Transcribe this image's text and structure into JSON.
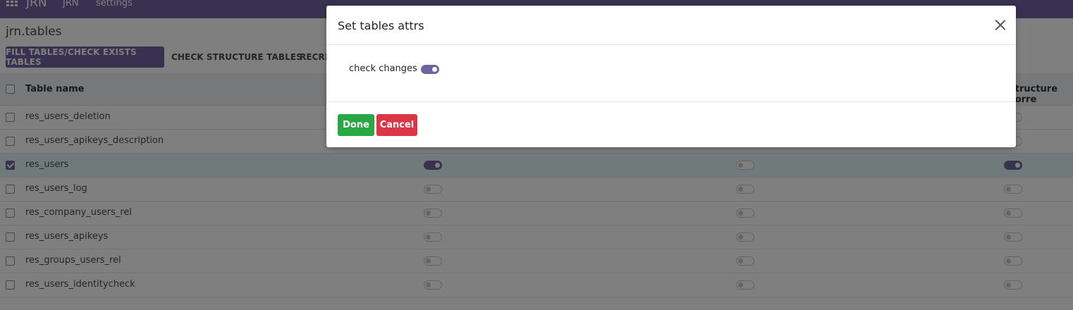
{
  "navbar": {
    "brand": "JRN",
    "menu_items": [
      "JRN",
      "settings"
    ]
  },
  "breadcrumb": "jrn.tables",
  "toolbar": {
    "fill_button": "FILL TABLES/CHECK EXISTS TABLES",
    "check_structure_button": "CHECK STRUCTURE TABLES",
    "recreate_button": "RECRE"
  },
  "table": {
    "header_name": "Table name",
    "header_structure": "structure corre",
    "rows": [
      {
        "name": "res_users_deletion",
        "selected": false,
        "toggles": [
          false,
          false,
          false
        ]
      },
      {
        "name": "res_users_apikeys_description",
        "selected": false,
        "toggles": [
          false,
          false,
          false
        ]
      },
      {
        "name": "res_users",
        "selected": true,
        "toggles": [
          true,
          false,
          true
        ]
      },
      {
        "name": "res_users_log",
        "selected": false,
        "toggles": [
          false,
          false,
          false
        ]
      },
      {
        "name": "res_company_users_rel",
        "selected": false,
        "toggles": [
          false,
          false,
          false
        ]
      },
      {
        "name": "res_users_apikeys",
        "selected": false,
        "toggles": [
          false,
          false,
          false
        ]
      },
      {
        "name": "res_groups_users_rel",
        "selected": false,
        "toggles": [
          false,
          false,
          false
        ]
      },
      {
        "name": "res_users_identitycheck",
        "selected": false,
        "toggles": [
          false,
          false,
          false
        ]
      }
    ]
  },
  "modal": {
    "title": "Set tables attrs",
    "field_label": "check changes",
    "field_value": true,
    "done_label": "Done",
    "cancel_label": "Cancel"
  },
  "colors": {
    "brand": "#71639e",
    "done": "#28a745",
    "cancel": "#dc3545",
    "selected_row": "#e3f5f4"
  }
}
